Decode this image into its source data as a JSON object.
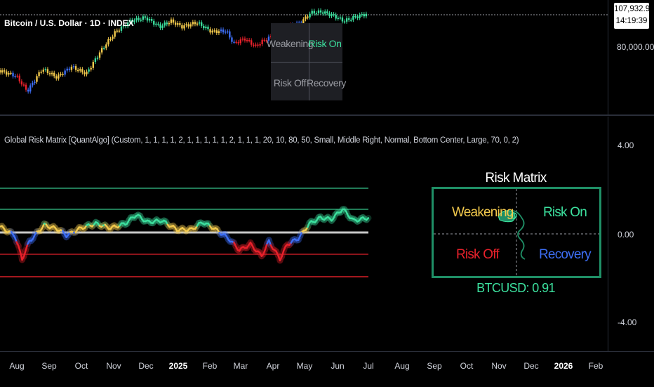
{
  "top_pane": {
    "symbol_title": "Bitcoin / U.S. Dollar · 1D · INDEX",
    "price_tag": {
      "price": "107,932.90",
      "countdown": "14:19:39"
    },
    "axis_partial_label": "80,000.00",
    "mini_matrix": {
      "top_left": "Weakening",
      "top_right": "Risk On",
      "bottom_left": "Risk Off",
      "bottom_right": "Recovery"
    }
  },
  "bottom_pane": {
    "indicator_title": "Global Risk Matrix [QuantAlgo] (Custom, 1, 1, 1, 1, 2, 1, 1, 1, 1, 1, 2, 1, 1, 1, 20, 10, 80, 50, Small, Middle Right, Normal, Bottom Center, Large, 70, 0, 2)",
    "axis_labels": [
      "4.00",
      "0.00",
      "-4.00"
    ],
    "risk_matrix": {
      "title": "Risk Matrix",
      "weakening": "Weakening",
      "risk_on": "Risk On",
      "risk_off": "Risk Off",
      "recovery": "Recovery",
      "readout": "BTCUSD: 0.91"
    }
  },
  "time_axis": [
    {
      "label": "Aug",
      "bold": false
    },
    {
      "label": "Sep",
      "bold": false
    },
    {
      "label": "Oct",
      "bold": false
    },
    {
      "label": "Nov",
      "bold": false
    },
    {
      "label": "Dec",
      "bold": false
    },
    {
      "label": "2025",
      "bold": true
    },
    {
      "label": "Feb",
      "bold": false
    },
    {
      "label": "Mar",
      "bold": false
    },
    {
      "label": "Apr",
      "bold": false
    },
    {
      "label": "May",
      "bold": false
    },
    {
      "label": "Jun",
      "bold": false
    },
    {
      "label": "Jul",
      "bold": false
    },
    {
      "label": "Aug",
      "bold": false
    },
    {
      "label": "Sep",
      "bold": false
    },
    {
      "label": "Oct",
      "bold": false
    },
    {
      "label": "Nov",
      "bold": false
    },
    {
      "label": "Dec",
      "bold": false
    },
    {
      "label": "2026",
      "bold": true
    },
    {
      "label": "Feb",
      "bold": false
    }
  ],
  "colors": {
    "risk_on": "#3ce09e",
    "weakening": "#f2c94c",
    "risk_off": "#e8212b",
    "recovery": "#3d6ef5",
    "matrix_border": "#1f8f66",
    "zero_line": "#c8c8c8"
  }
}
